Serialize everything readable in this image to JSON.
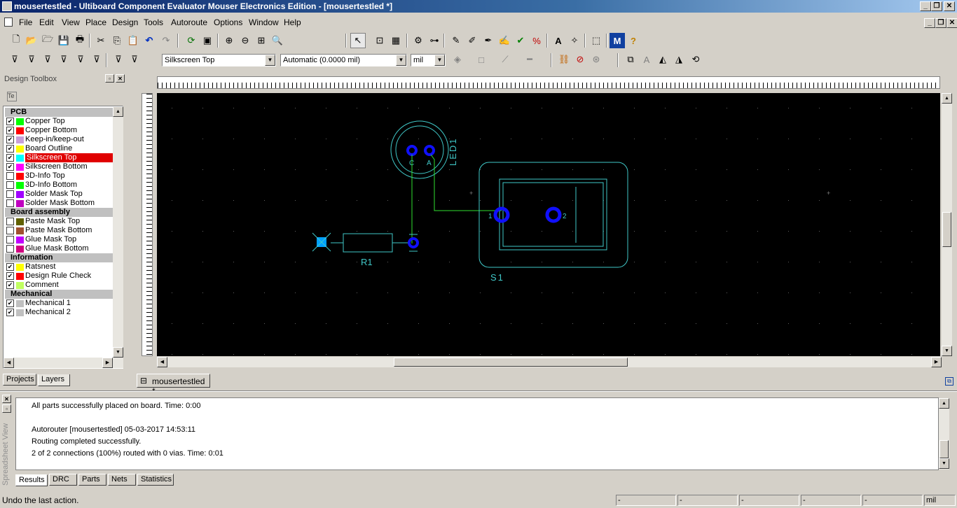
{
  "window": {
    "title": "mousertestled - Ultiboard Component Evaluator Mouser Electronics Edition - [mousertestled *]"
  },
  "menu": [
    "File",
    "Edit",
    "View",
    "Place",
    "Design",
    "Tools",
    "Autoroute",
    "Options",
    "Window",
    "Help"
  ],
  "toolbar2": {
    "layer_select": "Silkscreen Top",
    "width_select": "Automatic (0.0000 mil)",
    "unit_select": "mil"
  },
  "toolbox": {
    "title": "Design Toolbox",
    "filter_label": "Te",
    "groups": [
      {
        "name": "PCB",
        "layers": [
          {
            "label": "Copper Top",
            "checked": true,
            "color": "#00ff00"
          },
          {
            "label": "Copper Bottom",
            "checked": true,
            "color": "#ff0000"
          },
          {
            "label": "Keep-in/keep-out",
            "checked": true,
            "color": "#c8a0d8"
          },
          {
            "label": "Board Outline",
            "checked": true,
            "color": "#ffff00"
          },
          {
            "label": "Silkscreen Top",
            "checked": true,
            "color": "#00ffff",
            "selected": true
          },
          {
            "label": "Silkscreen Bottom",
            "checked": true,
            "color": "#ff00ff"
          },
          {
            "label": "3D-Info Top",
            "checked": false,
            "color": "#ff0000"
          },
          {
            "label": "3D-Info Bottom",
            "checked": false,
            "color": "#00ff00"
          },
          {
            "label": "Solder Mask Top",
            "checked": false,
            "color": "#a000ff"
          },
          {
            "label": "Solder Mask Bottom",
            "checked": false,
            "color": "#c000c0"
          }
        ]
      },
      {
        "name": "Board assembly",
        "layers": [
          {
            "label": "Paste Mask Top",
            "checked": false,
            "color": "#606000"
          },
          {
            "label": "Paste Mask Bottom",
            "checked": false,
            "color": "#a05030"
          },
          {
            "label": "Glue Mask Top",
            "checked": false,
            "color": "#c000ff"
          },
          {
            "label": "Glue Mask Bottom",
            "checked": false,
            "color": "#d00080"
          }
        ]
      },
      {
        "name": "Information",
        "layers": [
          {
            "label": "Ratsnest",
            "checked": true,
            "color": "#ffff00"
          },
          {
            "label": "Design Rule Check",
            "checked": true,
            "color": "#ff0000"
          },
          {
            "label": "Comment",
            "checked": true,
            "color": "#c0ff60"
          }
        ]
      },
      {
        "name": "Mechanical",
        "layers": [
          {
            "label": "Mechanical 1",
            "checked": true,
            "color": "#c0c0c0"
          },
          {
            "label": "Mechanical 2",
            "checked": true,
            "color": "#c0c0c0"
          }
        ]
      }
    ],
    "tabs": [
      "Projects",
      "Layers"
    ]
  },
  "document_tab": "mousertestled *",
  "board": {
    "labels": {
      "led": "LED1",
      "resistor": "R1",
      "switch": "S1",
      "pin_c": "C",
      "pin_a": "A",
      "pin1": "1",
      "pin2": "2"
    }
  },
  "output": {
    "side_label": "Spreadsheet View",
    "lines": [
      "All parts successfully placed on board.  Time: 0:00",
      "",
      "Autorouter [mousertestled]  05-03-2017 14:53:11",
      "Routing completed successfully.",
      "2 of 2 connections (100%) routed with 0 vias.  Time: 0:01"
    ],
    "tabs": [
      "Results",
      "DRC",
      "Parts",
      "Nets",
      "Statistics"
    ]
  },
  "status": {
    "message": "Undo the last action.",
    "fields": [
      "-",
      "-",
      "-",
      "-",
      "-",
      "mil"
    ]
  }
}
